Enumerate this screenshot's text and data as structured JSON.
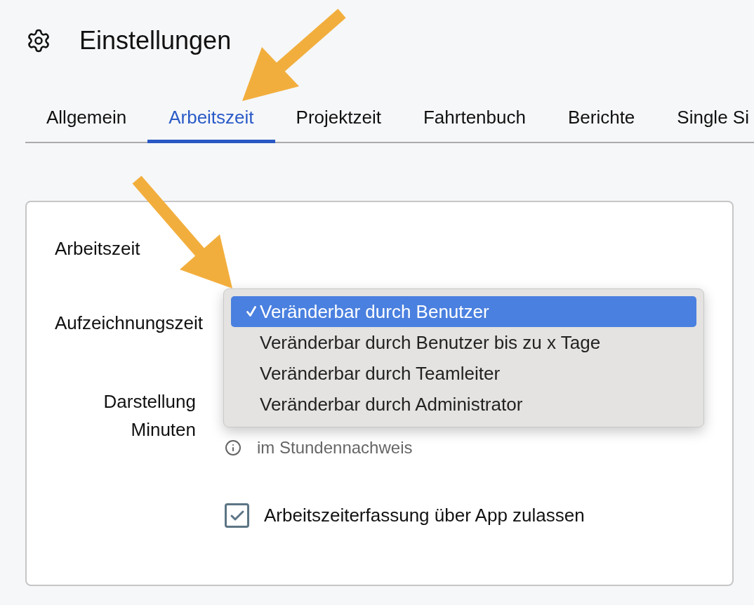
{
  "page": {
    "title": "Einstellungen"
  },
  "tabs": [
    {
      "label": "Allgemein",
      "selected": false
    },
    {
      "label": "Arbeitszeit",
      "selected": true
    },
    {
      "label": "Projektzeit",
      "selected": false
    },
    {
      "label": "Fahrtenbuch",
      "selected": false
    },
    {
      "label": "Berichte",
      "selected": false
    },
    {
      "label": "Single Si",
      "selected": false
    }
  ],
  "card": {
    "title": "Arbeitszeit",
    "recording_time": {
      "label": "Aufzeichnungszeit",
      "dropdown": {
        "options": [
          {
            "label": "Veränderbar durch Benutzer",
            "selected": true
          },
          {
            "label": "Veränderbar durch Benutzer bis zu x Tage",
            "selected": false
          },
          {
            "label": "Veränderbar durch Teamleiter",
            "selected": false
          },
          {
            "label": "Veränderbar durch Administrator",
            "selected": false
          }
        ]
      }
    },
    "display": {
      "label": "Darstellung Minuten",
      "hint": "im Stundennachweis"
    },
    "app_capture": {
      "label": "Arbeitszeiterfassung über App zulassen",
      "checked": true
    }
  }
}
